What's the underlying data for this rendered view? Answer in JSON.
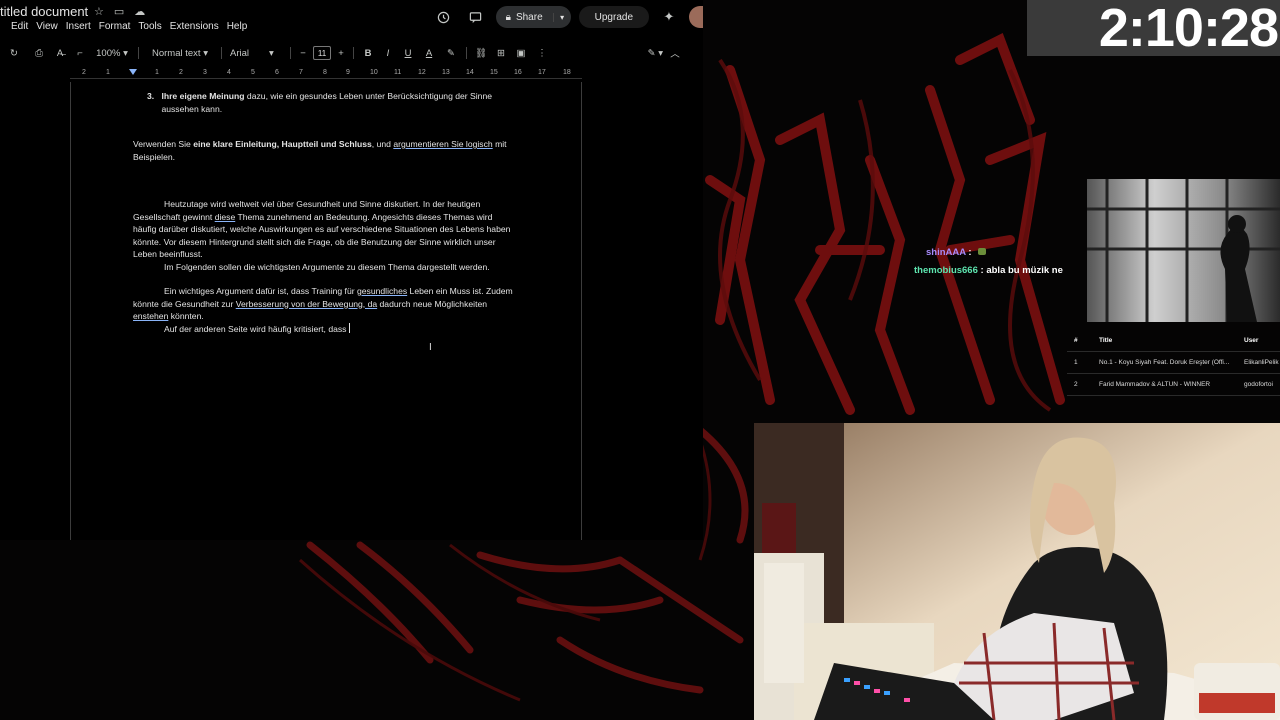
{
  "docs": {
    "title": "titled document",
    "menu": [
      "Edit",
      "View",
      "Insert",
      "Format",
      "Tools",
      "Extensions",
      "Help"
    ],
    "share_label": "Share",
    "upgrade_label": "Upgrade",
    "zoom": "100%",
    "style": "Normal text",
    "font": "Arial",
    "font_size": "11",
    "ruler_ticks": [
      "2",
      "1",
      "1",
      "2",
      "3",
      "4",
      "5",
      "6",
      "7",
      "8",
      "9",
      "10",
      "11",
      "12",
      "13",
      "14",
      "15",
      "16",
      "17",
      "18"
    ],
    "list_item": {
      "number": "3.",
      "bold": "Ihre eigene Meinung",
      "rest": " dazu, wie ein gesundes Leben unter Berücksichtigung der Sinne aussehen kann."
    },
    "instruction": {
      "pre": "Verwenden Sie ",
      "bold": "eine klare Einleitung, Hauptteil und Schluss",
      "mid": ", und ",
      "underlined": "argumentieren Sie logisch",
      "post": " mit Beispielen."
    },
    "para1": {
      "a": "Heutzutage wird weltweit viel über Gesundheit und Sinne diskutiert. In der heutigen Gesellschaft gewinnt ",
      "u1": "diese",
      "b": " Thema zunehmend an Bedeutung. Angesichts dieses Themas wird häufig darüber diskutiert, welche Auswirkungen es auf verschiedene Situationen des Lebens haben könnte. Vor diesem Hintergrund stellt sich die Frage, ob die Benutzung der Sinne wirklich unser Leben beeinflusst."
    },
    "para1b": "Im Folgenden sollen die wichtigsten Argumente zu diesem Thema dargestellt werden.",
    "para2": {
      "a": "Ein wichtiges Argument dafür ist, dass Training für ",
      "u1": "gesundliches",
      "b": " Leben ein Muss ist. Zudem könnte die Gesundheit zur ",
      "u2": "Verbesserung von der Bewegung, da",
      "c": " dadurch neue Möglichkeiten ",
      "u3": "enstehen",
      "d": " könnten."
    },
    "para3": "Auf der anderen Seite wird häufig kritisiert, dass "
  },
  "timer": "2:10:28",
  "chat": [
    {
      "user": "shinAAA",
      "sep": " : ",
      "message": "",
      "color": "#a78bfa"
    },
    {
      "user": "themobius666",
      "sep": " : ",
      "message": "abla bu müzik ne",
      "color": "#5ee6b0"
    }
  ],
  "songs": {
    "headers": [
      "#",
      "Title",
      "User"
    ],
    "rows": [
      {
        "n": "1",
        "title": "No.1 - Koyu Siyah Feat. Doruk Ereşter (Offi...",
        "user": "ElikanliPelik"
      },
      {
        "n": "2",
        "title": "Farid Mammadov & ALTUN - WINNER",
        "user": "godofortoi"
      }
    ]
  },
  "colors": {
    "accent_red": "#8b1414",
    "chat_user1": "#a78bfa",
    "chat_user2": "#5ee6b0"
  }
}
